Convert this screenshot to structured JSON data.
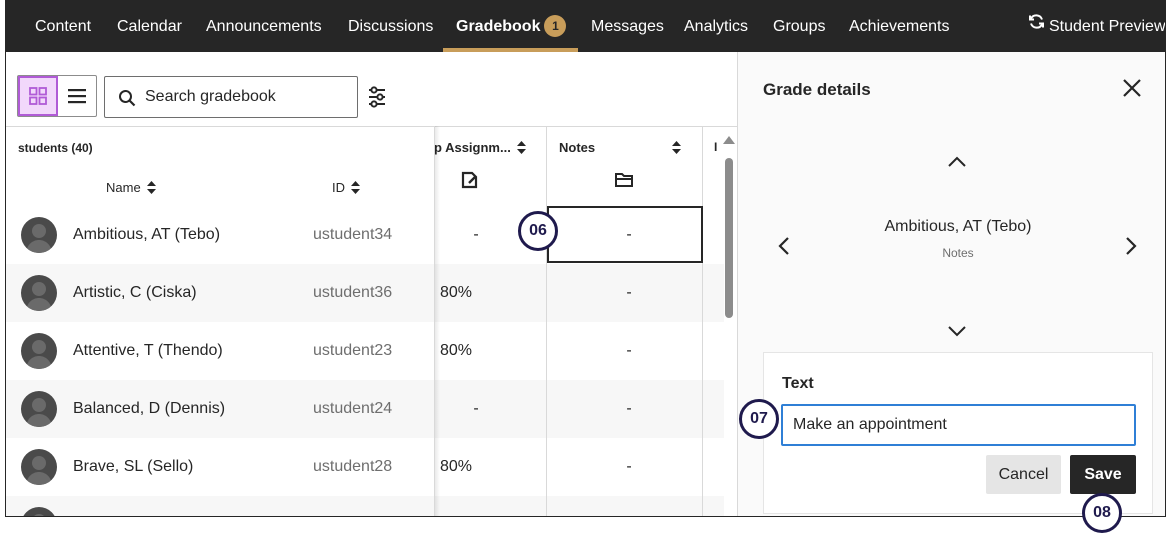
{
  "nav": {
    "items": [
      "Content",
      "Calendar",
      "Announcements",
      "Discussions",
      "Gradebook",
      "Messages",
      "Analytics",
      "Groups",
      "Achievements"
    ],
    "active": "Gradebook",
    "gradebook_badge": "1",
    "student_preview": "Student Preview"
  },
  "toolbar": {
    "search_placeholder": "Search gradebook"
  },
  "grid": {
    "students_count": "students (40)",
    "columns": {
      "name": "Name",
      "id": "ID",
      "assignment": "p Assignm...",
      "notes": "Notes",
      "last": "I"
    },
    "rows": [
      {
        "name": "Ambitious, AT (Tebo)",
        "id": "ustudent34",
        "grade": "-",
        "notes": "-"
      },
      {
        "name": "Artistic, C (Ciska)",
        "id": "ustudent36",
        "grade": "80%",
        "notes": "-"
      },
      {
        "name": "Attentive, T (Thendo)",
        "id": "ustudent23",
        "grade": "80%",
        "notes": "-"
      },
      {
        "name": "Balanced, D (Dennis)",
        "id": "ustudent24",
        "grade": "-",
        "notes": "-"
      },
      {
        "name": "Brave, SL (Sello)",
        "id": "ustudent28",
        "grade": "80%",
        "notes": "-"
      }
    ]
  },
  "callouts": {
    "c06": "06",
    "c07": "07",
    "c08": "08"
  },
  "panel": {
    "title": "Grade details",
    "student_name": "Ambitious, AT (Tebo)",
    "column_name": "Notes",
    "text_label": "Text",
    "text_value": "Make an appointment",
    "cancel_label": "Cancel",
    "save_label": "Save"
  },
  "colors": {
    "nav_bg": "#262626",
    "accent_gold": "#c89d5a",
    "toggle_purple": "#b05bd6",
    "callout_navy": "#1f1a4d",
    "input_focus_blue": "#2f7fd6"
  }
}
